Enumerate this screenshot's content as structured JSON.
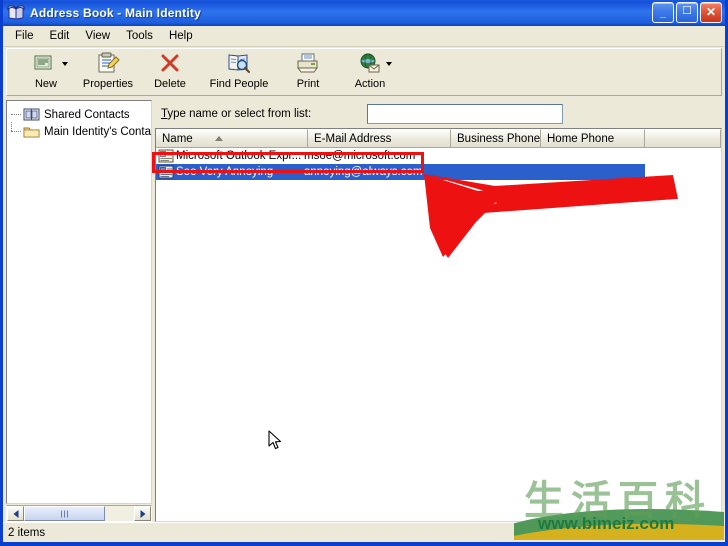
{
  "window": {
    "title": "Address Book - Main Identity",
    "icon": "address-book-icon",
    "controls": {
      "minimize": "_",
      "maximize": "❐",
      "close": "✕"
    }
  },
  "menu": {
    "items": [
      {
        "label": "File"
      },
      {
        "label": "Edit"
      },
      {
        "label": "View"
      },
      {
        "label": "Tools"
      },
      {
        "label": "Help"
      }
    ]
  },
  "toolbar": {
    "buttons": [
      {
        "label": "New",
        "icon": "new-contact-icon",
        "dropdown": true
      },
      {
        "label": "Properties",
        "icon": "properties-icon",
        "dropdown": false
      },
      {
        "label": "Delete",
        "icon": "delete-x-icon",
        "dropdown": false
      },
      {
        "label": "Find People",
        "icon": "find-people-icon",
        "dropdown": false
      },
      {
        "label": "Print",
        "icon": "printer-icon",
        "dropdown": false
      },
      {
        "label": "Action",
        "icon": "action-globe-icon",
        "dropdown": true
      }
    ]
  },
  "tree": {
    "nodes": [
      {
        "label": "Shared Contacts",
        "icon": "shared-contacts-book-icon"
      },
      {
        "label": "Main Identity's Conta",
        "icon": "folder-icon"
      }
    ]
  },
  "find": {
    "label_prefix": "T",
    "label_rest": "ype name or select from list:",
    "value": "",
    "placeholder": ""
  },
  "list": {
    "columns": [
      {
        "label": "Name",
        "sort": "asc"
      },
      {
        "label": "E-Mail Address",
        "sort": ""
      },
      {
        "label": "Business Phone",
        "sort": ""
      },
      {
        "label": "Home Phone",
        "sort": ""
      }
    ],
    "rows": [
      {
        "name": "Microsoft Outlook Expr...",
        "email": "msoe@microsoft.com",
        "business_phone": "",
        "home_phone": "",
        "icon": "contact-card-icon",
        "selected": false
      },
      {
        "name": "Soe Very Annoying",
        "email": "annoying@always.com",
        "business_phone": "",
        "home_phone": "",
        "icon": "contact-card-icon",
        "selected": true
      }
    ]
  },
  "status": {
    "text": "2 items"
  },
  "annotations": {
    "highlight_box_color": "#ee1111",
    "arrow_color": "#ee1111",
    "arrow_label": "red-arrow-pointing-to-selected-contact"
  },
  "watermark": {
    "characters": "生活百科",
    "url": "www.bimeiz.com"
  },
  "colors": {
    "titlebar_blue": "#1c5ddd",
    "selection_blue": "#2a5fcc",
    "window_face": "#ece9d8",
    "border_blue": "#0a3fcf"
  }
}
